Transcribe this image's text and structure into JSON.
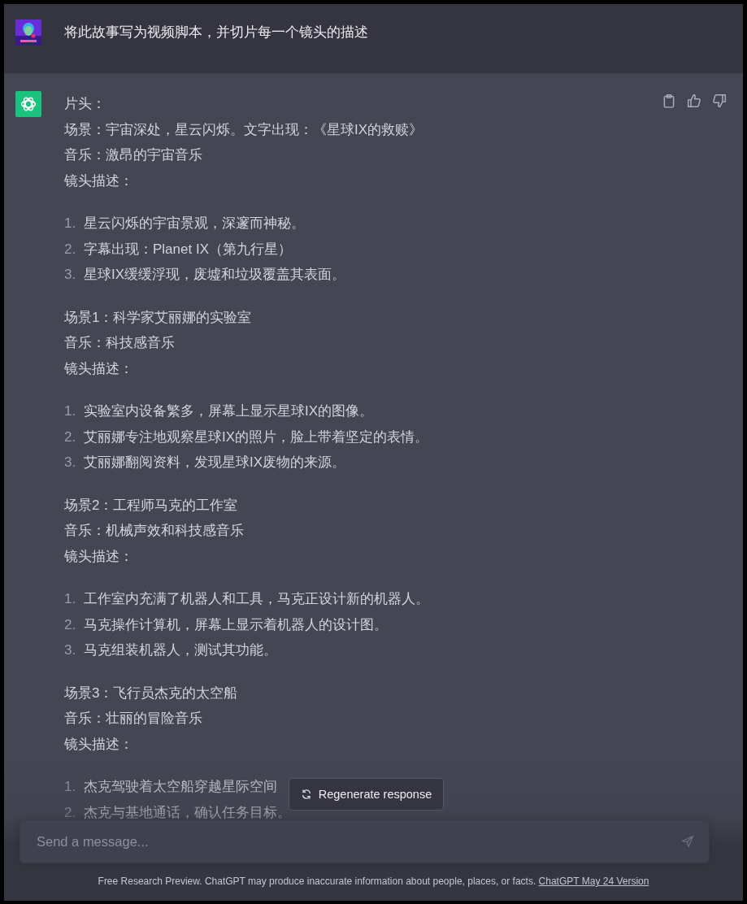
{
  "user_message": {
    "text": "将此故事写为视频脚本，并切片每一个镜头的描述"
  },
  "assistant_message": {
    "sections": [
      {
        "lines": [
          "片头：",
          "场景：宇宙深处，星云闪烁。文字出现：《星球IX的救赎》",
          "音乐：激昂的宇宙音乐",
          "镜头描述："
        ],
        "list": [
          {
            "number": "1.",
            "text": "星云闪烁的宇宙景观，深邃而神秘。"
          },
          {
            "number": "2.",
            "text": "字幕出现：Planet IX（第九行星）"
          },
          {
            "number": "3.",
            "text": "星球IX缓缓浮现，废墟和垃圾覆盖其表面。"
          }
        ]
      },
      {
        "lines": [
          "场景1：科学家艾丽娜的实验室",
          "音乐：科技感音乐",
          "镜头描述："
        ],
        "list": [
          {
            "number": "1.",
            "text": "实验室内设备繁多，屏幕上显示星球IX的图像。"
          },
          {
            "number": "2.",
            "text": "艾丽娜专注地观察星球IX的照片，脸上带着坚定的表情。"
          },
          {
            "number": "3.",
            "text": "艾丽娜翻阅资料，发现星球IX废物的来源。"
          }
        ]
      },
      {
        "lines": [
          "场景2：工程师马克的工作室",
          "音乐：机械声效和科技感音乐",
          "镜头描述："
        ],
        "list": [
          {
            "number": "1.",
            "text": "工作室内充满了机器人和工具，马克正设计新的机器人。"
          },
          {
            "number": "2.",
            "text": "马克操作计算机，屏幕上显示着机器人的设计图。"
          },
          {
            "number": "3.",
            "text": "马克组装机器人，测试其功能。"
          }
        ]
      },
      {
        "lines": [
          "场景3：飞行员杰克的太空船",
          "音乐：壮丽的冒险音乐",
          "镜头描述："
        ],
        "list": [
          {
            "number": "1.",
            "text": "杰克驾驶着太空船穿越星际空间"
          },
          {
            "number": "2.",
            "text": "杰克与基地通话，确认任务目标。"
          }
        ]
      }
    ]
  },
  "regenerate_button": {
    "label": "Regenerate response"
  },
  "message_input": {
    "placeholder": "Send a message..."
  },
  "footer": {
    "text": "Free Research Preview. ChatGPT may produce inaccurate information about people, places, or facts.",
    "link": "ChatGPT May 24 Version"
  }
}
